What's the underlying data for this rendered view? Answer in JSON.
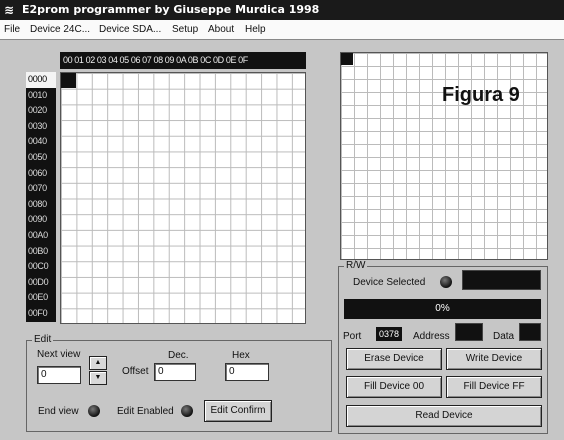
{
  "window": {
    "title": "E2prom programmer by Giuseppe Murdica 1998"
  },
  "menu": [
    "File",
    "Device 24C...",
    "Device SDA...",
    "Setup",
    "About",
    "Help"
  ],
  "hex_header": "00 01 02 03 04 05 06 07 08 09 0A 0B 0C 0D 0E 0F",
  "addresses": [
    "0000",
    "0010",
    "0020",
    "0030",
    "0040",
    "0050",
    "0060",
    "0070",
    "0080",
    "0090",
    "00A0",
    "00B0",
    "00C0",
    "00D0",
    "00E0",
    "00F0"
  ],
  "figure_label": "Figura 9",
  "edit": {
    "group_label": "Edit",
    "next_view_label": "Next view",
    "next_view_value": "0",
    "spin_up": "▲",
    "spin_down": "▼",
    "offset_label": "Offset",
    "dec_label": "Dec.",
    "dec_value": "0",
    "hex_label": "Hex",
    "hex_value": "0",
    "end_view_label": "End view",
    "edit_enabled_label": "Edit Enabled",
    "edit_confirm_button": "Edit Confirm"
  },
  "rw": {
    "group_label": "R/W",
    "device_selected_label": "Device Selected",
    "progress_text": "0%",
    "progress": 0,
    "port_label": "Port",
    "port_value": "0378",
    "address_label": "Address",
    "data_label": "Data",
    "buttons": {
      "erase": "Erase Device",
      "write": "Write Device",
      "fill00": "Fill Device 00",
      "fillff": "Fill Device FF",
      "read": "Read Device"
    }
  }
}
